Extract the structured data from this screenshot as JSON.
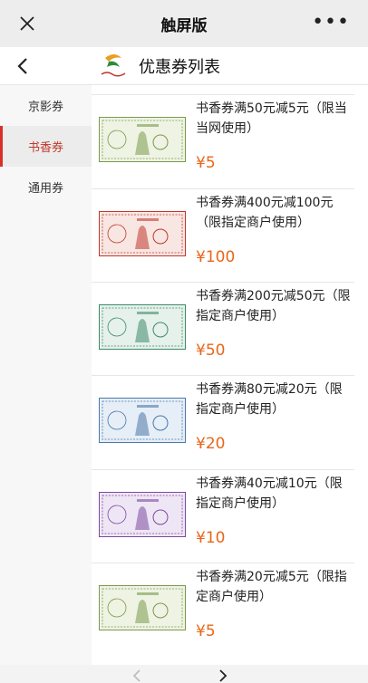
{
  "topbar": {
    "title": "触屏版",
    "more_label": "•••"
  },
  "header": {
    "title": "优惠券列表"
  },
  "sidebar": {
    "items": [
      {
        "label": "京影券",
        "active": false
      },
      {
        "label": "书香券",
        "active": true
      },
      {
        "label": "通用券",
        "active": false
      }
    ]
  },
  "coupons": [
    {
      "name": "书香券满50元减5元（限当当网使用）",
      "price": "¥5",
      "color": "#7a9a4a",
      "tint": "#eef3e4"
    },
    {
      "name": "书香券满400元减100元（限指定商户使用）",
      "price": "¥100",
      "color": "#c0392b",
      "tint": "#f8e6e3"
    },
    {
      "name": "书香券满200元减50元（限指定商户使用）",
      "price": "¥50",
      "color": "#3e8a6a",
      "tint": "#e5f1ea"
    },
    {
      "name": "书香券满80元减20元（限指定商户使用）",
      "price": "¥20",
      "color": "#4a78a8",
      "tint": "#e6eef7"
    },
    {
      "name": "书香券满40元减10元（限指定商户使用）",
      "price": "¥10",
      "color": "#7b4aa0",
      "tint": "#efe6f5"
    },
    {
      "name": "书香券满20元减5元（限指定商户使用）",
      "price": "¥5",
      "color": "#7a9a4a",
      "tint": "#eef3e4"
    }
  ],
  "colors": {
    "accent": "#d9302a",
    "price": "#e8661a"
  }
}
